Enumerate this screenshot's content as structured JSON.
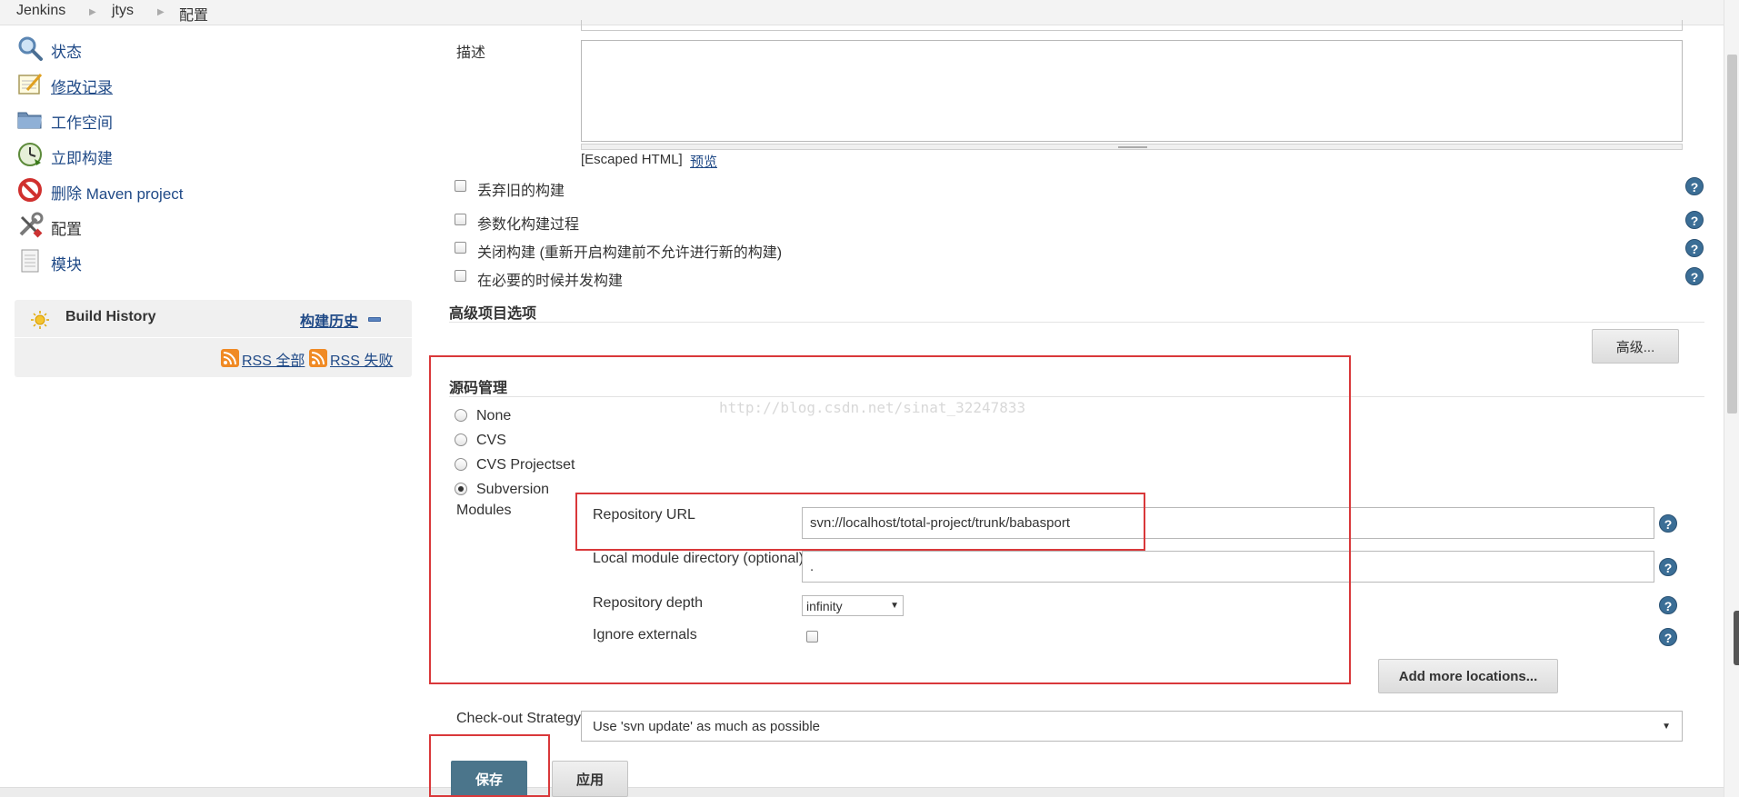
{
  "breadcrumb": {
    "items": [
      "Jenkins",
      "jtys",
      "配置"
    ]
  },
  "sidebar": {
    "tasks": [
      {
        "label": "状态",
        "icon": "search-icon"
      },
      {
        "label": "修改记录",
        "icon": "notepad-icon"
      },
      {
        "label": "工作空间",
        "icon": "folder-icon"
      },
      {
        "label": "立即构建",
        "icon": "build-clock-icon"
      },
      {
        "label": "删除 Maven project",
        "icon": "no-entry-icon"
      },
      {
        "label": "配置",
        "icon": "tools-icon"
      },
      {
        "label": "模块",
        "icon": "document-icon"
      }
    ],
    "build_history": {
      "title": "Build History",
      "trend_link": "构建历史",
      "rss_all": "RSS 全部",
      "rss_failed": "RSS 失败"
    }
  },
  "form": {
    "description_label": "描述",
    "escaped_html": "[Escaped HTML]",
    "preview_link": "预览",
    "options": [
      {
        "label": "丢弃旧的构建",
        "checked": false
      },
      {
        "label": "参数化构建过程",
        "checked": false
      },
      {
        "label": "关闭构建 (重新开启构建前不允许进行新的构建)",
        "checked": false
      },
      {
        "label": "在必要的时候并发构建",
        "checked": false
      }
    ],
    "advanced_section_title": "高级项目选项",
    "advanced_button": "高级...",
    "scm_section_title": "源码管理",
    "watermark": "http://blog.csdn.net/sinat_32247833",
    "scm_options": [
      {
        "label": "None",
        "selected": false
      },
      {
        "label": "CVS",
        "selected": false
      },
      {
        "label": "CVS Projectset",
        "selected": false
      },
      {
        "label": "Subversion",
        "selected": true
      }
    ],
    "modules_label": "Modules",
    "repository_url_label": "Repository URL",
    "repository_url_value": "svn://localhost/total-project/trunk/babasport",
    "local_module_label": "Local module directory (optional)",
    "local_module_value": ".",
    "repository_depth_label": "Repository depth",
    "repository_depth_value": "infinity",
    "ignore_externals_label": "Ignore externals",
    "add_locations_button": "Add more locations...",
    "checkout_strategy_label": "Check-out Strategy",
    "checkout_strategy_value": "Use 'svn update' as much as possible",
    "save_button": "保存",
    "apply_button": "应用"
  },
  "colors": {
    "link": "#204a87",
    "save_button": "#4b758b",
    "highlight_box": "#d9383a",
    "help_icon": "#3b6e96"
  }
}
